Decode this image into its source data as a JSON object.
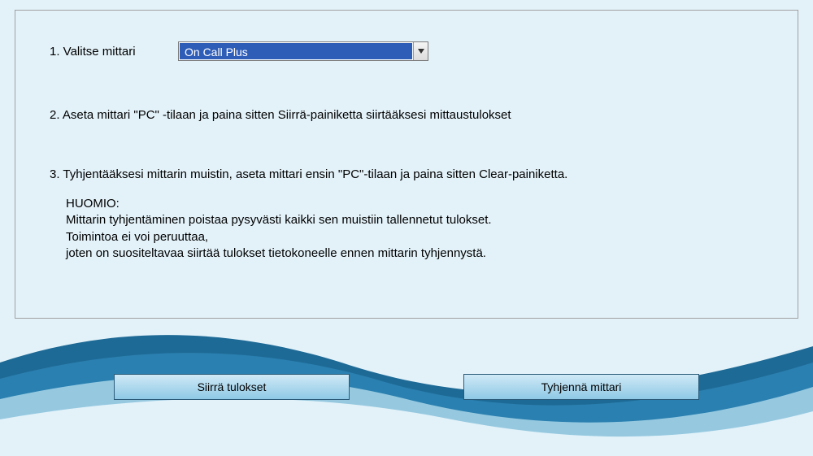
{
  "step1": {
    "label": "1. Valitse mittari",
    "selected": "On Call Plus"
  },
  "step2": {
    "text": "2. Aseta mittari \"PC\" -tilaan ja paina sitten Siirrä-painiketta siirtääksesi mittaustulokset"
  },
  "step3": {
    "text": "3. Tyhjentääksesi mittarin muistin, aseta mittari ensin \"PC\"-tilaan ja paina sitten Clear-painiketta."
  },
  "note": {
    "line1": "HUOMIO:",
    "line2": "Mittarin tyhjentäminen poistaa pysyvästi kaikki sen muistiin tallennetut tulokset.",
    "line3": "Toimintoa ei voi peruuttaa,",
    "line4": "joten on suositeltavaa siirtää tulokset tietokoneelle ennen mittarin tyhjennystä."
  },
  "buttons": {
    "transfer": "Siirrä tulokset",
    "clear": "Tyhjennä mittari"
  }
}
